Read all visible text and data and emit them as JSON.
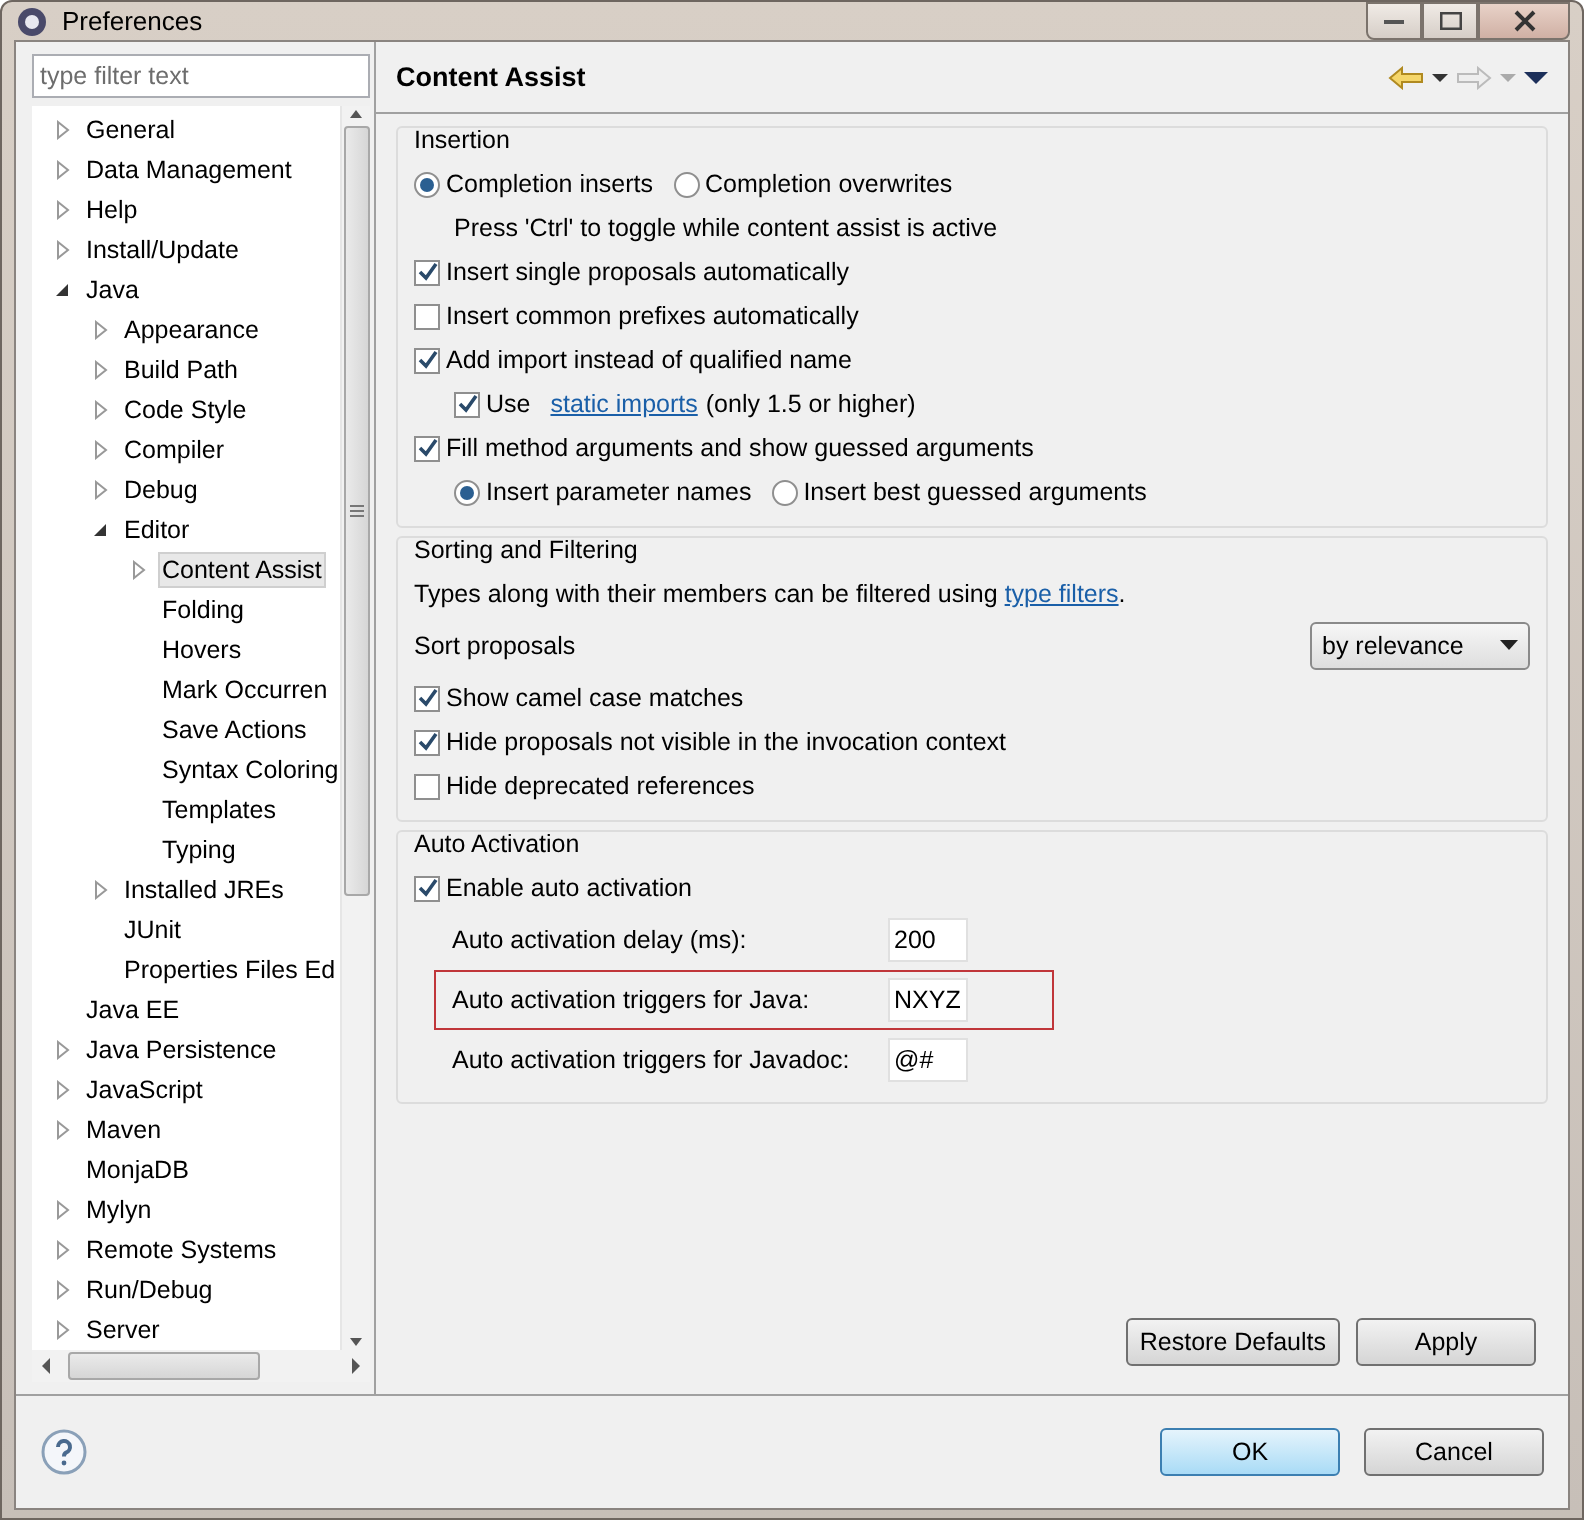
{
  "window": {
    "title": "Preferences"
  },
  "filter": {
    "placeholder": "type filter text"
  },
  "tree": [
    {
      "label": "General",
      "expanded": false,
      "selected": false
    },
    {
      "label": "Data Management",
      "expanded": false,
      "selected": false
    },
    {
      "label": "Help",
      "expanded": false,
      "selected": false
    },
    {
      "label": "Install/Update",
      "expanded": false,
      "selected": false
    },
    {
      "label": "Java",
      "expanded": true,
      "selected": false,
      "children": [
        {
          "label": "Appearance",
          "expanded": false,
          "selected": false
        },
        {
          "label": "Build Path",
          "expanded": false,
          "selected": false
        },
        {
          "label": "Code Style",
          "expanded": false,
          "selected": false
        },
        {
          "label": "Compiler",
          "expanded": false,
          "selected": false
        },
        {
          "label": "Debug",
          "expanded": false,
          "selected": false
        },
        {
          "label": "Editor",
          "expanded": true,
          "selected": false,
          "children": [
            {
              "label": "Content Assist",
              "expanded": false,
              "selected": true
            },
            {
              "label": "Folding",
              "selected": false
            },
            {
              "label": "Hovers",
              "selected": false
            },
            {
              "label": "Mark Occurren",
              "selected": false
            },
            {
              "label": "Save Actions",
              "selected": false
            },
            {
              "label": "Syntax Coloring",
              "selected": false
            },
            {
              "label": "Templates",
              "selected": false
            },
            {
              "label": "Typing",
              "selected": false
            }
          ]
        },
        {
          "label": "Installed JREs",
          "expanded": false,
          "selected": false
        },
        {
          "label": "JUnit",
          "selected": false
        },
        {
          "label": "Properties Files Ed",
          "selected": false
        }
      ]
    },
    {
      "label": "Java EE",
      "selected": false
    },
    {
      "label": "Java Persistence",
      "expanded": false,
      "selected": false
    },
    {
      "label": "JavaScript",
      "expanded": false,
      "selected": false
    },
    {
      "label": "Maven",
      "expanded": false,
      "selected": false
    },
    {
      "label": "MonjaDB",
      "selected": false
    },
    {
      "label": "Mylyn",
      "expanded": false,
      "selected": false
    },
    {
      "label": "Remote Systems",
      "expanded": false,
      "selected": false
    },
    {
      "label": "Run/Debug",
      "expanded": false,
      "selected": false
    },
    {
      "label": "Server",
      "expanded": false,
      "selected": false
    }
  ],
  "page": {
    "title": "Content Assist"
  },
  "insertion": {
    "title": "Insertion",
    "items": [
      {
        "kind": "radios",
        "options": [
          {
            "label": "Completion inserts",
            "selected": true
          },
          {
            "label": "Completion overwrites",
            "selected": false
          }
        ]
      },
      {
        "kind": "note",
        "text": "Press 'Ctrl' to toggle while content assist is active"
      },
      {
        "kind": "checkbox",
        "label": "Insert single proposals automatically",
        "checked": true
      },
      {
        "kind": "checkbox",
        "label": "Insert common prefixes automatically",
        "checked": false
      },
      {
        "kind": "checkbox",
        "label": "Add import instead of qualified name",
        "checked": true,
        "children": [
          {
            "kind": "checkbox",
            "label": "Use",
            "link": "static imports",
            "after": "(only 1.5 or higher)",
            "checked": true
          }
        ]
      },
      {
        "kind": "checkbox",
        "label": "Fill method arguments and show guessed arguments",
        "checked": true,
        "children": [
          {
            "kind": "radios",
            "options": [
              {
                "label": "Insert parameter names",
                "selected": true
              },
              {
                "label": "Insert best guessed arguments",
                "selected": false
              }
            ]
          }
        ]
      }
    ]
  },
  "sorting": {
    "title": "Sorting and Filtering",
    "description": {
      "text": "Types along with their members can be filtered using",
      "link": "type filters",
      "after": "."
    },
    "sort": {
      "label": "Sort proposals",
      "value": "by relevance"
    },
    "checkboxes": [
      {
        "label": "Show camel case matches",
        "checked": true
      },
      {
        "label": "Hide proposals not visible in the invocation context",
        "checked": true
      },
      {
        "label": "Hide deprecated references",
        "checked": false
      }
    ]
  },
  "auto_activation": {
    "title": "Auto Activation",
    "enable": {
      "label": "Enable auto activation",
      "checked": true
    },
    "fields": [
      {
        "label": "Auto activation delay (ms):",
        "value": "200",
        "highlighted": false
      },
      {
        "label": "Auto activation triggers for Java:",
        "value": "NXYZ",
        "highlighted": true
      },
      {
        "label": "Auto activation triggers for Javadoc:",
        "value": "@#",
        "highlighted": false
      }
    ]
  },
  "page_buttons": [
    "Restore Defaults",
    "Apply"
  ],
  "dialog_buttons": [
    {
      "label": "OK",
      "default": true
    },
    {
      "label": "Cancel",
      "default": false
    }
  ]
}
